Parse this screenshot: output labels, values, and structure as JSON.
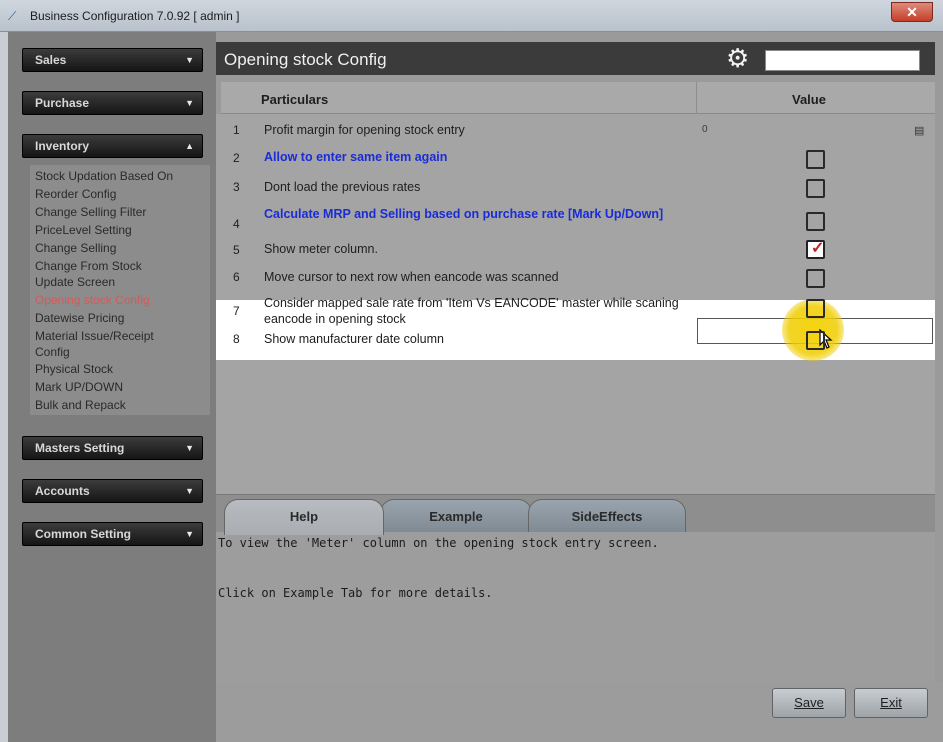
{
  "window": {
    "title": "Business Configuration 7.0.92 [ admin ]",
    "close_label": "✕"
  },
  "sidebar": {
    "sections": [
      {
        "label": "Sales",
        "icon": "double-chevron-down-icon"
      },
      {
        "label": "Purchase",
        "icon": "double-chevron-down-icon"
      },
      {
        "label": "Inventory",
        "icon": "double-chevron-up-icon"
      },
      {
        "label": "Masters Setting",
        "icon": "double-chevron-down-icon"
      },
      {
        "label": "Accounts",
        "icon": "double-chevron-down-icon"
      },
      {
        "label": "Common Setting",
        "icon": "double-chevron-down-icon"
      }
    ],
    "inventory_items": [
      "Stock Updation Based On",
      "Reorder Config",
      "Change Selling Filter",
      "PriceLevel Setting",
      "Change Selling",
      "Change From Stock",
      "Update Screen",
      "Opening stock Config",
      "Datewise Pricing",
      "Material Issue/Receipt",
      "Config",
      "Physical Stock",
      "Mark UP/DOWN",
      "Bulk and Repack"
    ],
    "active_item": "Opening stock Config"
  },
  "main": {
    "title": "Opening stock Config",
    "header_icon": "gear-icon",
    "columns": {
      "particulars": "Particulars",
      "value": "Value"
    },
    "rows": [
      {
        "no": "1",
        "text": "Profit margin for opening stock entry",
        "value": "0"
      },
      {
        "no": "2",
        "text": "Allow to enter same item again"
      },
      {
        "no": "3",
        "text": "Dont load the previous rates"
      },
      {
        "no": "4",
        "text": "Calculate MRP and Selling based on purchase rate [Mark Up/Down]"
      },
      {
        "no": "5",
        "text": "Show meter column.",
        "checked": true
      },
      {
        "no": "6",
        "text": "Move cursor to next row when eancode was scanned"
      },
      {
        "no": "7",
        "text": "Consider mapped sale rate from 'Item Vs EANCODE' master while scaning eancode in opening stock"
      },
      {
        "no": "8",
        "text": "Show manufacturer date column"
      }
    ]
  },
  "tabs": [
    {
      "label": "Help"
    },
    {
      "label": "Example"
    },
    {
      "label": "SideEffects"
    }
  ],
  "help": {
    "line1": "To view the 'Meter' column on the opening stock entry screen.",
    "line2": "Click on Example Tab for more details."
  },
  "footer": {
    "save_label": "Save",
    "exit_label": "Exit"
  },
  "colors": {
    "active_item": "#d35a5a",
    "blue_text": "#1a2bd8",
    "checkmark": "#c0241d",
    "cursor_highlight": "#f2d200"
  }
}
